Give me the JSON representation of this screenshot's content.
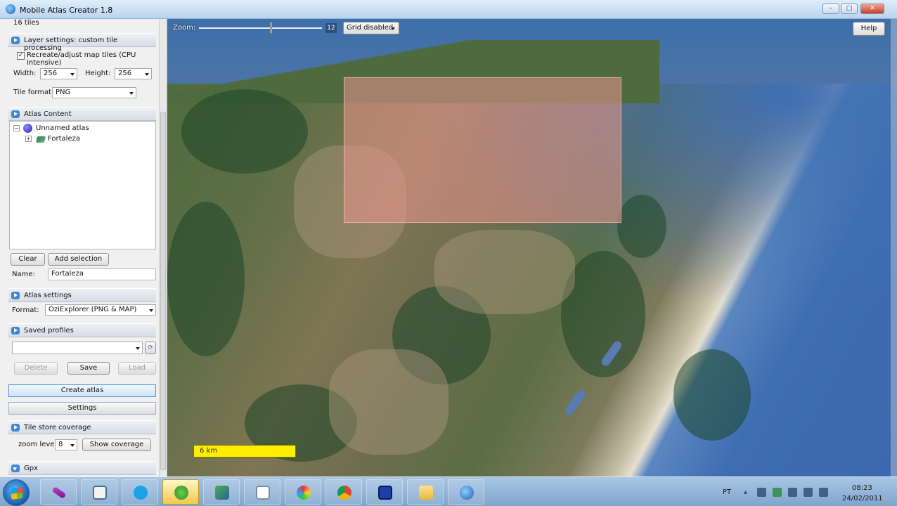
{
  "window": {
    "title": "Mobile Atlas Creator 1.8",
    "minimize": "–",
    "maximize": "□",
    "close": "✕"
  },
  "panel": {
    "tiles_count": "16 tiles",
    "layer_settings": {
      "title": "Layer settings: custom tile processing",
      "recreate_label": "Recreate/adjust map tiles (CPU intensive)",
      "recreate_checked": true,
      "width_label": "Width:",
      "width_value": "256",
      "height_label": "Height:",
      "height_value": "256",
      "tile_format_label": "Tile format:",
      "tile_format_value": "PNG"
    },
    "atlas_content": {
      "title": "Atlas Content",
      "atlas_name": "Unnamed atlas",
      "layer_name": "Fortaleza",
      "clear_button": "Clear",
      "add_selection_button": "Add selection",
      "name_label": "Name:",
      "name_value": "Fortaleza"
    },
    "atlas_settings": {
      "title": "Atlas settings",
      "format_label": "Format:",
      "format_value": "OziExplorer (PNG & MAP)"
    },
    "saved_profiles": {
      "title": "Saved profiles",
      "profile_value": "",
      "delete_button": "Delete",
      "save_button": "Save",
      "load_button": "Load"
    },
    "create_atlas_button": "Create atlas",
    "settings_button": "Settings",
    "tile_store": {
      "title": "Tile store coverage",
      "zoom_level_label": "zoom level",
      "zoom_level_value": "8",
      "show_coverage_button": "Show coverage"
    },
    "gpx": {
      "title": "Gpx"
    }
  },
  "map": {
    "zoom_label": "Zoom:",
    "zoom_value": "12",
    "grid_value": "Grid disabled",
    "help_button": "Help",
    "scale_text": "6 km"
  },
  "taskbar": {
    "language": "PT",
    "time": "08:23",
    "date": "24/02/2011"
  }
}
